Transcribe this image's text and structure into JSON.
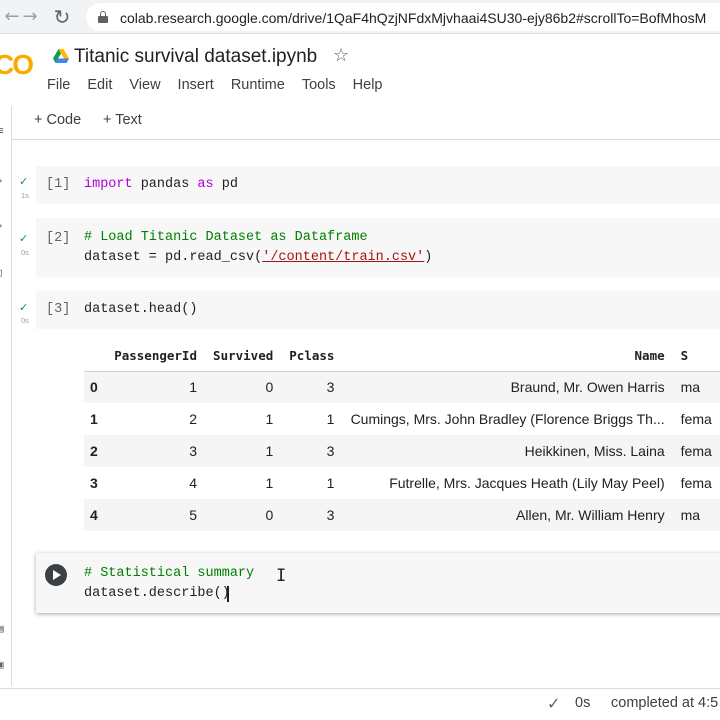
{
  "browser": {
    "back_glyph": "←",
    "forward_glyph": "→",
    "reload_glyph": "↻",
    "url": "colab.research.google.com/drive/1QaF4hQzjNFdxMjvhaai4SU30-ejy86b2#scrollTo=BofMhosM"
  },
  "header": {
    "logo_text": "CO",
    "title": "Titanic survival dataset.ipynb",
    "star_glyph": "☆",
    "menu": [
      "File",
      "Edit",
      "View",
      "Insert",
      "Runtime",
      "Tools",
      "Help"
    ]
  },
  "toolbar": {
    "add_code_label": "+ Code",
    "add_text_label": "+ Text"
  },
  "cells": [
    {
      "count": "[1]",
      "time": "1s",
      "code": {
        "kw1": "import",
        "mid": " pandas ",
        "kw2": "as",
        "end": " pd"
      }
    },
    {
      "count": "[2]",
      "time": "0s",
      "comment": "# Load Titanic Dataset as Dataframe",
      "code_prefix": "dataset = ",
      "code_fn": "pd.read_csv(",
      "code_str": "'/content/train.csv'",
      "code_suffix": ")"
    },
    {
      "count": "[3]",
      "time": "0s",
      "code": "dataset.head()"
    }
  ],
  "output_table": {
    "columns": [
      "",
      "PassengerId",
      "Survived",
      "Pclass",
      "Name",
      "S"
    ],
    "rows": [
      [
        "0",
        "1",
        "0",
        "3",
        "Braund, Mr. Owen Harris",
        "ma"
      ],
      [
        "1",
        "2",
        "1",
        "1",
        "Cumings, Mrs. John Bradley (Florence Briggs Th...",
        "fema"
      ],
      [
        "2",
        "3",
        "1",
        "3",
        "Heikkinen, Miss. Laina",
        "fema"
      ],
      [
        "3",
        "4",
        "1",
        "1",
        "Futrelle, Mrs. Jacques Heath (Lily May Peel)",
        "fema"
      ],
      [
        "4",
        "5",
        "0",
        "3",
        "Allen, Mr. William Henry",
        "ma"
      ]
    ]
  },
  "active_cell": {
    "comment": "# Statistical summary",
    "code": "dataset.describe()"
  },
  "status": {
    "time": "0s",
    "message": "completed at 4:5"
  },
  "colors": {
    "colab_orange": "#f9ab00",
    "check_green": "#1e8e3e",
    "keyword_purple": "#af00db",
    "comment_green": "#008000",
    "string_red": "#a31515"
  }
}
